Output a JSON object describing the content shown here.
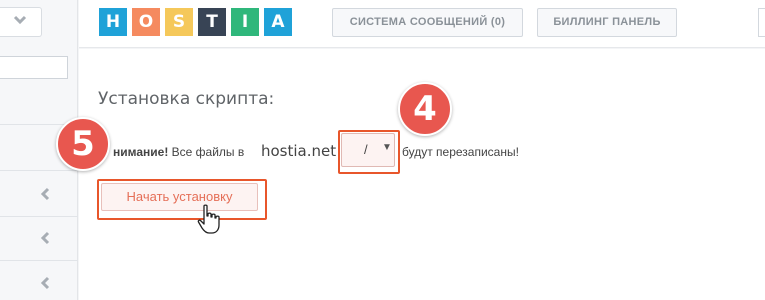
{
  "header": {
    "logo_letters": [
      {
        "char": "H",
        "color": "#1fa2d8"
      },
      {
        "char": "O",
        "color": "#f58a5f"
      },
      {
        "char": "S",
        "color": "#f5c85a"
      },
      {
        "char": "T",
        "color": "#384455"
      },
      {
        "char": "I",
        "color": "#2fb77b"
      },
      {
        "char": "A",
        "color": "#1fa2d8"
      }
    ],
    "messages_button": "СИСТЕМА СООБЩЕНИЙ (0)",
    "billing_button": "БИЛЛИНГ ПАНЕЛЬ"
  },
  "main": {
    "title": "Установка скрипта:",
    "warning_bold": "нимание!",
    "warning_text": " Все файлы в",
    "domain": "hostia.net",
    "path_value": "/",
    "after_text": "будут перезаписаны!",
    "start_button": "Начать установку"
  },
  "annotations": {
    "step_select": "4",
    "step_start": "5",
    "accent_color": "#e8562b"
  }
}
